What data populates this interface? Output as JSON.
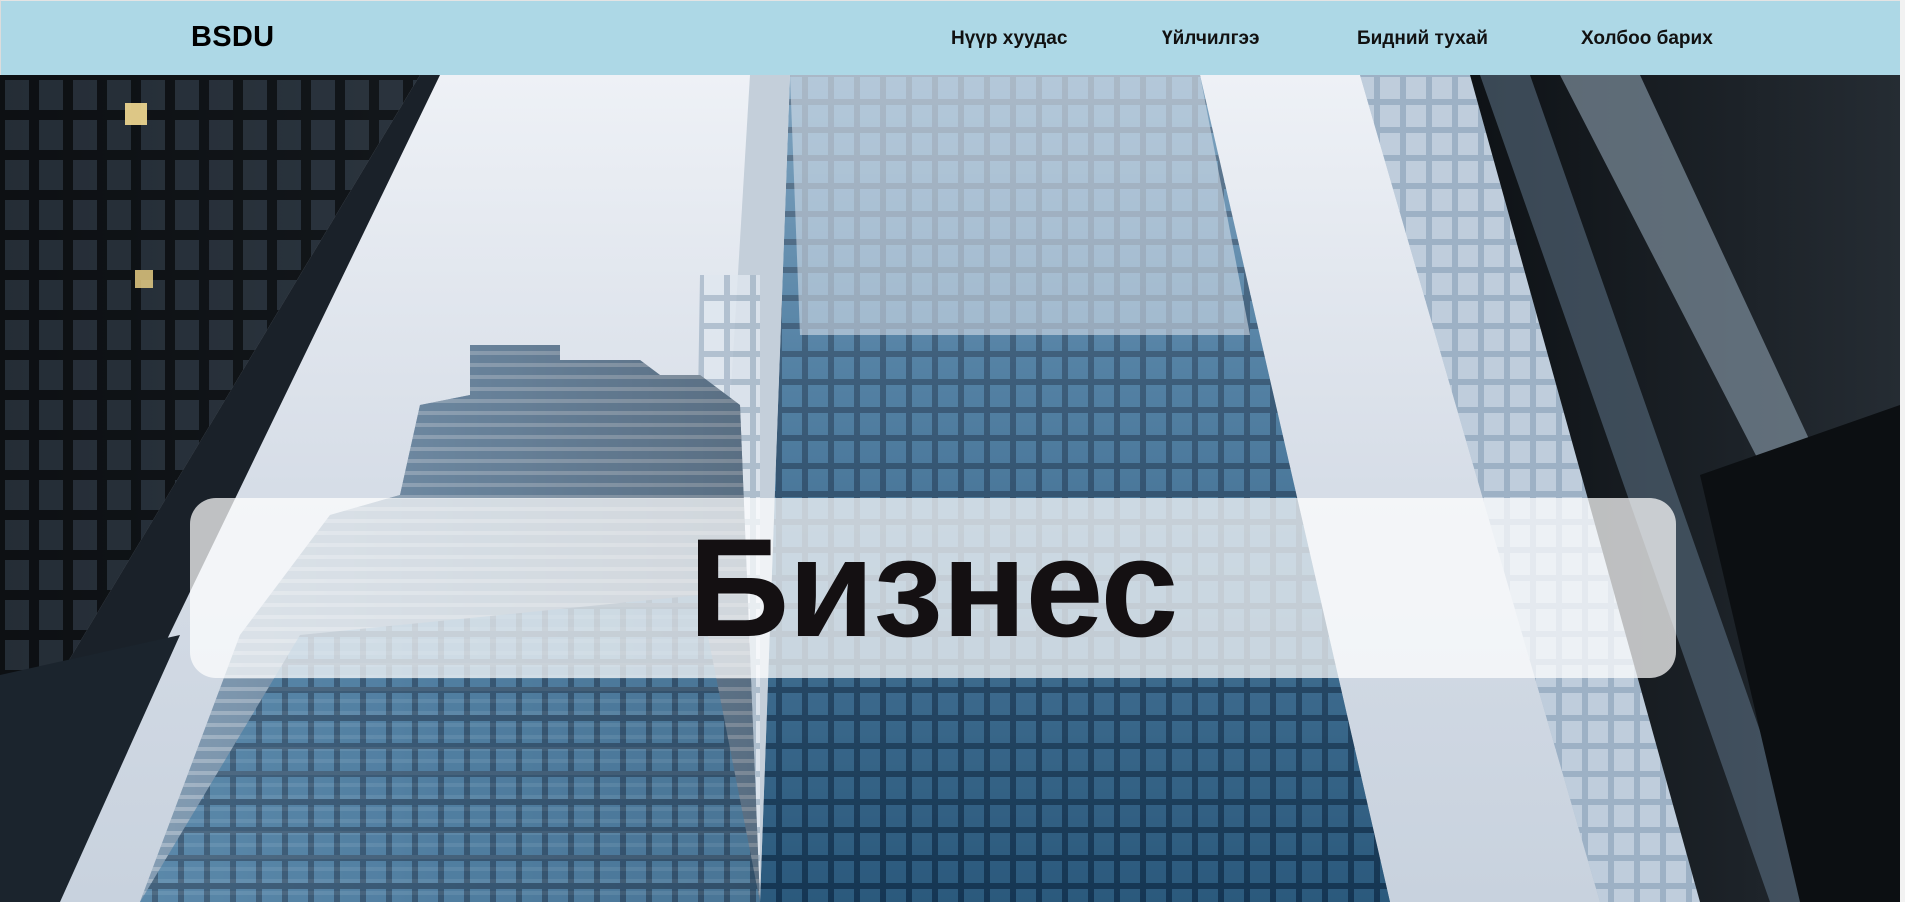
{
  "header": {
    "logo": "BSDU",
    "nav": [
      {
        "label": "Нүүр хуудас"
      },
      {
        "label": "Үйлчилгээ"
      },
      {
        "label": "Бидний тухай"
      },
      {
        "label": "Холбоо барих"
      }
    ]
  },
  "hero": {
    "title": "Бизнес",
    "background_image": "glass-skyscrapers-photo"
  },
  "colors": {
    "header_bg": "#add8e6",
    "title_text": "#141012",
    "banner_bg": "rgba(255,255,255,0.72)"
  }
}
